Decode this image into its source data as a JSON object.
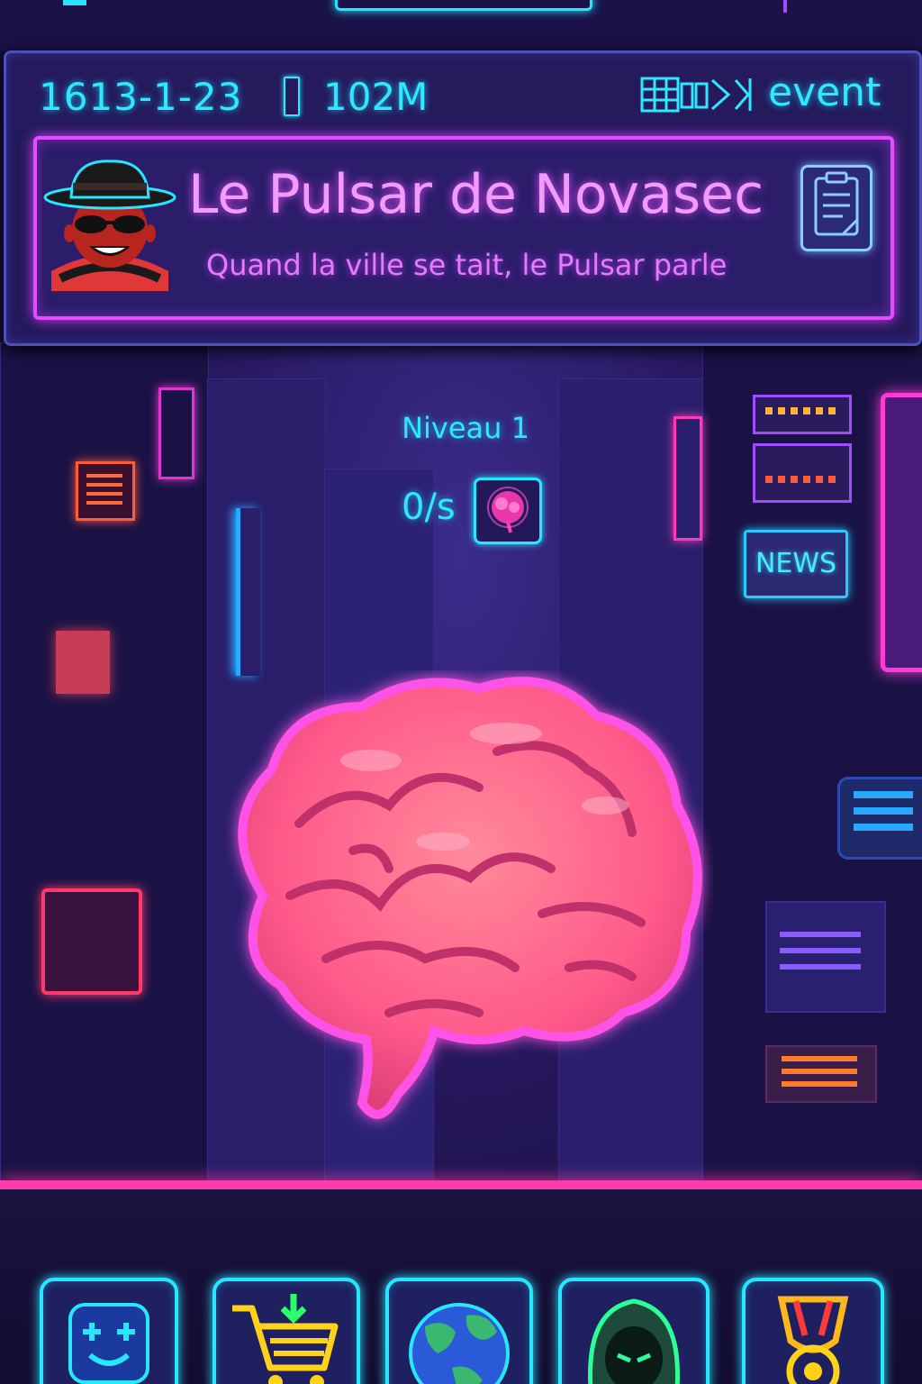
{
  "status_bar": {
    "date": "1613-1-23",
    "money": "102M",
    "event_label": "event"
  },
  "header": {
    "title": "Le Pulsar de Novasec",
    "subtitle": "Quand la ville se tait, le Pulsar parle"
  },
  "game": {
    "level": "Niveau 1",
    "rate": "0/s"
  },
  "news_button": {
    "label": "NEWS"
  },
  "nav": [
    {
      "icon": "smiley-robot-icon"
    },
    {
      "icon": "shopping-cart-icon"
    },
    {
      "icon": "globe-icon"
    },
    {
      "icon": "hooded-agent-icon"
    },
    {
      "icon": "medal-icon"
    }
  ],
  "colors": {
    "neon_cyan": "#2fe8ff",
    "neon_pink": "#e44cff",
    "brain_pink": "#ff5aa8",
    "background": "#241a5c"
  }
}
